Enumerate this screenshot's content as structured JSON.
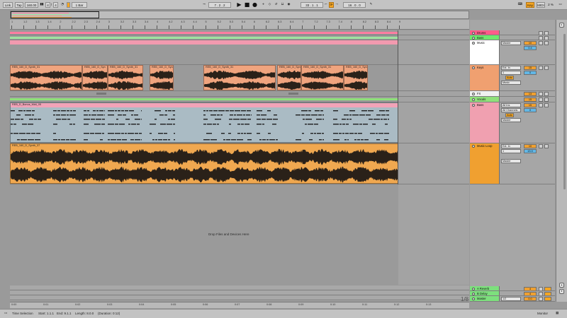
{
  "control_bar": {
    "link_label": "Link",
    "tap_label": "Tap",
    "tempo": "160.00",
    "time_sig_num": "4",
    "time_sig_den": "4",
    "quantize": "1 Bar",
    "position": "7 . 2 . 2",
    "loop_start": "33 . 1 . 1",
    "loop_length": "16 . 0 . 0",
    "key_label": "Key",
    "midi_label": "MIDI",
    "cpu_load": "2 %"
  },
  "ruler": {
    "bars": [
      "1",
      "1.2",
      "1.3",
      "1.4",
      "2",
      "2.2",
      "2.3",
      "2.4",
      "3",
      "3.2",
      "3.3",
      "3.4",
      "4",
      "4.2",
      "4.3",
      "4.4",
      "5",
      "5.2",
      "5.3",
      "5.4",
      "6",
      "6.2",
      "6.3",
      "6.4",
      "7",
      "7.2",
      "7.3",
      "7.4",
      "8",
      "8.2",
      "8.3",
      "8.4",
      "9"
    ]
  },
  "tracks": [
    {
      "name": "Drums",
      "color": "#ff5c8a"
    },
    {
      "name": "Bass",
      "color": "#6ee86e"
    },
    {
      "name": "Music",
      "color": "#ffffff",
      "routing": "Master",
      "volume": "10",
      "pan": "0.4"
    },
    {
      "name": "Keys",
      "color": "#f0a070",
      "input": "Ext. In",
      "input_channel": "1",
      "volume": "15",
      "pan": "0",
      "monitor": "Auto",
      "routing": "Music"
    },
    {
      "name": "FX",
      "color": "#f0f0f0",
      "volume": "13"
    },
    {
      "name": "Vocals",
      "color": "#8fe07a",
      "volume": "15"
    },
    {
      "name": "Bass",
      "color": "#f0a0b0",
      "input": "All Ins",
      "input_channel": "All Channels",
      "volume": "15",
      "pan": "0",
      "monitor": "Auto",
      "routing": "Master"
    },
    {
      "name": "Music Loop",
      "color": "#f0a030",
      "input": "Ext. In",
      "input_channel": "1",
      "volume": "10",
      "pan": "13.0",
      "routing": "Master"
    }
  ],
  "returns": [
    {
      "name": "A Reverb",
      "color": "#7de07d",
      "volume": "4"
    },
    {
      "name": "B Delay",
      "color": "#7de07d",
      "volume": "4"
    },
    {
      "name": "Master",
      "color": "#7de07d",
      "routing": "1/2",
      "volume": "0.0"
    }
  ],
  "clips": {
    "keys_clip_name": "REB_160_D_Synth_31",
    "keys_clip_short": "REB_160_D_Syn",
    "bass_clip_name": "REB_D_Bonus_Midi_05",
    "loop_clip_name": "REB_160_D_Synth_37"
  },
  "drop_hint": "Drop Files and Devices Here",
  "time_labels": [
    "0:00",
    "0:01",
    "0:02",
    "0:03",
    "0:04",
    "0:05",
    "0:06",
    "0:07",
    "0:08",
    "0:09",
    "0:10",
    "0:11",
    "0:12",
    "0:13"
  ],
  "zoom_display": "1/8",
  "status": {
    "selection": "Time Selection",
    "start": "Start: 1.1.1",
    "end": "End: 9.1.1",
    "length": "Length: 8.0.0",
    "duration": "(Duration: 0:12)",
    "monitor_label": "Monitor"
  },
  "colors": {
    "keys_clip": "#f0a47e",
    "bass_clip": "#aabbc4",
    "loop_clip": "#f0a850",
    "drums_strip": "#ff7ca0",
    "bass_strip": "#9fe39f",
    "waveform": "#2a2119",
    "midi_note": "#1f1f1f"
  }
}
